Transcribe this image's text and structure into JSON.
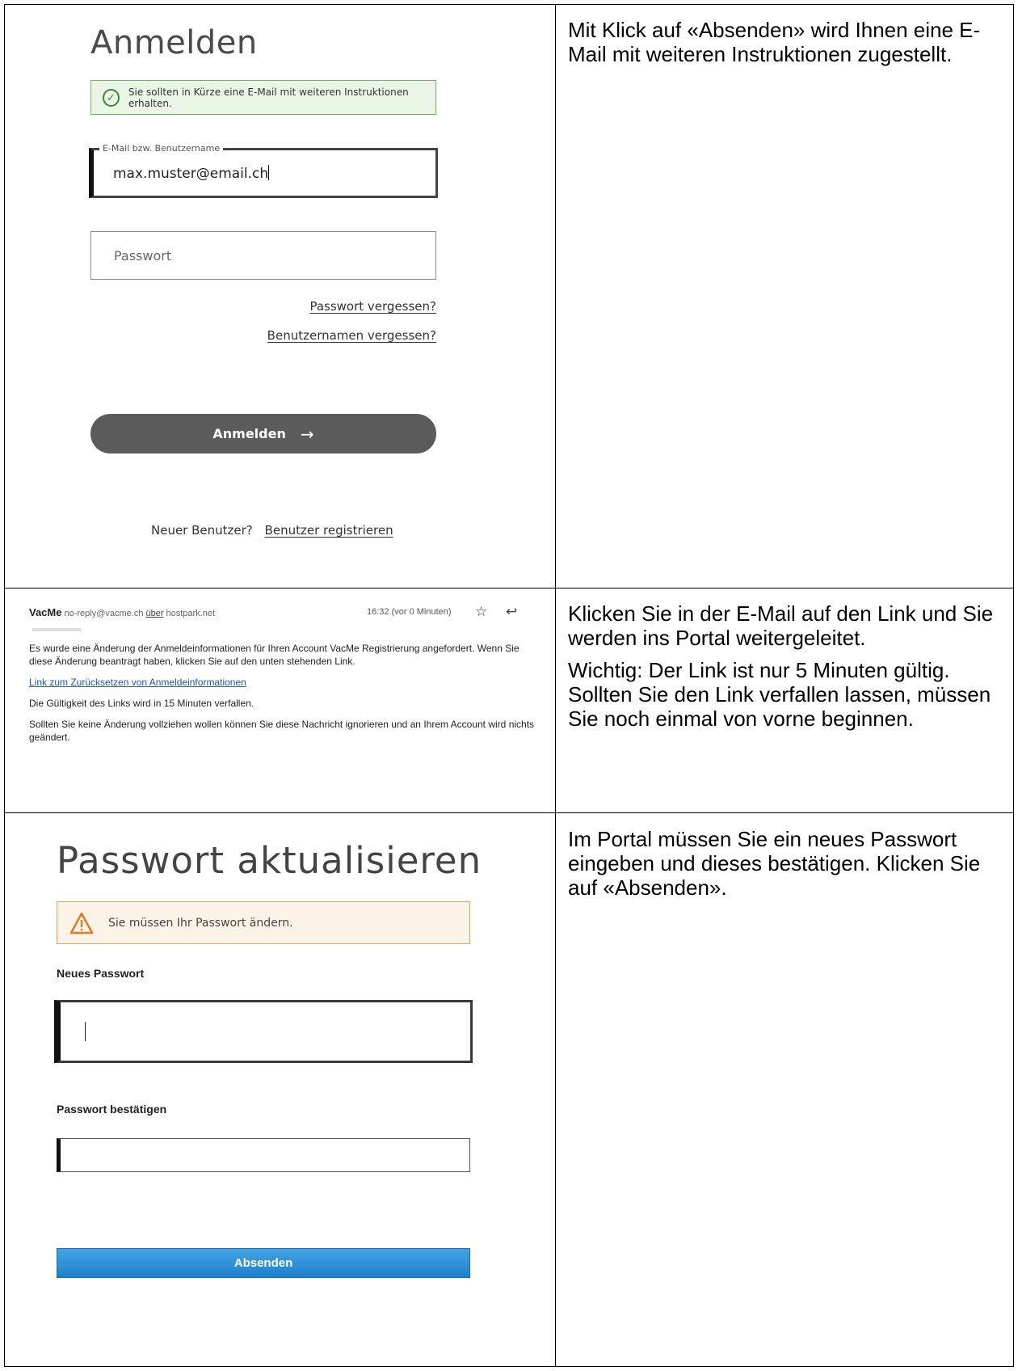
{
  "rows": [
    {
      "description": [
        "Mit Klick auf «Absenden» wird Ihnen eine E-Mail mit weiteren Instruktionen zugestellt."
      ]
    },
    {
      "description": [
        "Klicken Sie in der E-Mail auf den Link und Sie werden ins Portal weitergeleitet.",
        "Wichtig: Der Link ist nur 5 Minuten gültig. Sollten Sie den Link verfallen lassen, müssen Sie noch einmal von vorne beginnen."
      ]
    },
    {
      "description": [
        "Im Portal müssen Sie ein neues Passwort eingeben und dieses bestätigen. Klicken Sie auf «Absenden»."
      ]
    }
  ],
  "login": {
    "title": "Anmelden",
    "success_message": "Sie sollten in Kürze eine E-Mail mit weiteren Instruktionen erhalten.",
    "email_label": "E-Mail bzw. Benutzername",
    "email_value": "max.muster@email.ch",
    "password_placeholder": "Passwort",
    "forgot_password": "Passwort vergessen?",
    "forgot_username": "Benutzernamen vergessen?",
    "login_button": "Anmelden",
    "login_arrow": "→",
    "new_user": "Neuer Benutzer?",
    "register_link": "Benutzer registrieren"
  },
  "email": {
    "sender": "VacMe",
    "address": "no-reply@vacme.ch",
    "via": "über",
    "host": "hostpark.net",
    "time": "16:32 (vor 0 Minuten)",
    "star": "☆",
    "reply": "↩",
    "body1": "Es wurde eine Änderung der Anmeldeinformationen für Ihren Account VacMe Registrierung angefordert. Wenn Sie diese Änderung beantragt haben, klicken Sie auf den unten stehenden Link.",
    "link": "Link zum Zurücksetzen von Anmeldeinformationen",
    "validity": "Die Gültigkeit des Links wird in 15 Minuten verfallen.",
    "ignore": "Sollten Sie keine Änderung vollziehen wollen können Sie diese Nachricht ignorieren und an Ihrem Account wird nichts geändert."
  },
  "update": {
    "title": "Passwort aktualisieren",
    "warning": "Sie müssen Ihr Passwort ändern.",
    "new_password_label": "Neues Passwort",
    "confirm_password_label": "Passwort bestätigen",
    "submit_button": "Absenden"
  },
  "colors": {
    "success_border": "#6db35c",
    "warning_border": "#e3a35a",
    "submit_blue": "#2a8ad6",
    "login_button": "#5b5b5b",
    "link_blue": "#1a55c4"
  }
}
